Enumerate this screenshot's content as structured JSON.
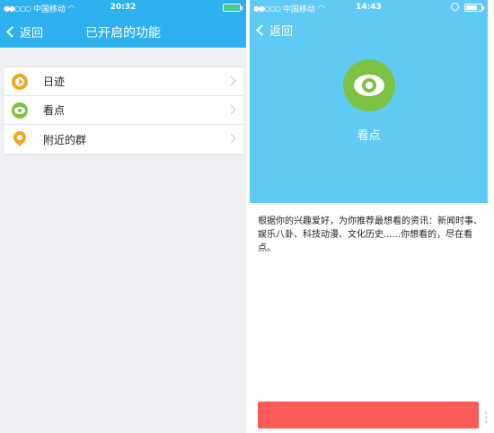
{
  "left": {
    "status": {
      "carrier": "中国移动",
      "time": "20:32"
    },
    "nav": {
      "back_label": "返回",
      "title": "已开启的功能"
    },
    "items": [
      {
        "label": "日迹",
        "icon": "play-circle-icon",
        "color": "#f5a623"
      },
      {
        "label": "看点",
        "icon": "eye-icon",
        "color": "#7dc242"
      },
      {
        "label": "附近的群",
        "icon": "location-pin-icon",
        "color": "#f5a623"
      }
    ]
  },
  "right": {
    "status": {
      "carrier": "中国移动",
      "time": "14:43"
    },
    "nav": {
      "back_label": "返回"
    },
    "feature_name": "看点",
    "description": "根据你的兴趣爱好，为你推荐最想看的资讯：新闻时事、娱乐八卦、科技动漫、文化历史......你想看的，尽在看点。",
    "button_color": "#fa5b57"
  },
  "colors": {
    "accent": "#2fb1f0",
    "hero": "#5fcbf5",
    "green": "#7dc242",
    "orange": "#f5a623"
  }
}
